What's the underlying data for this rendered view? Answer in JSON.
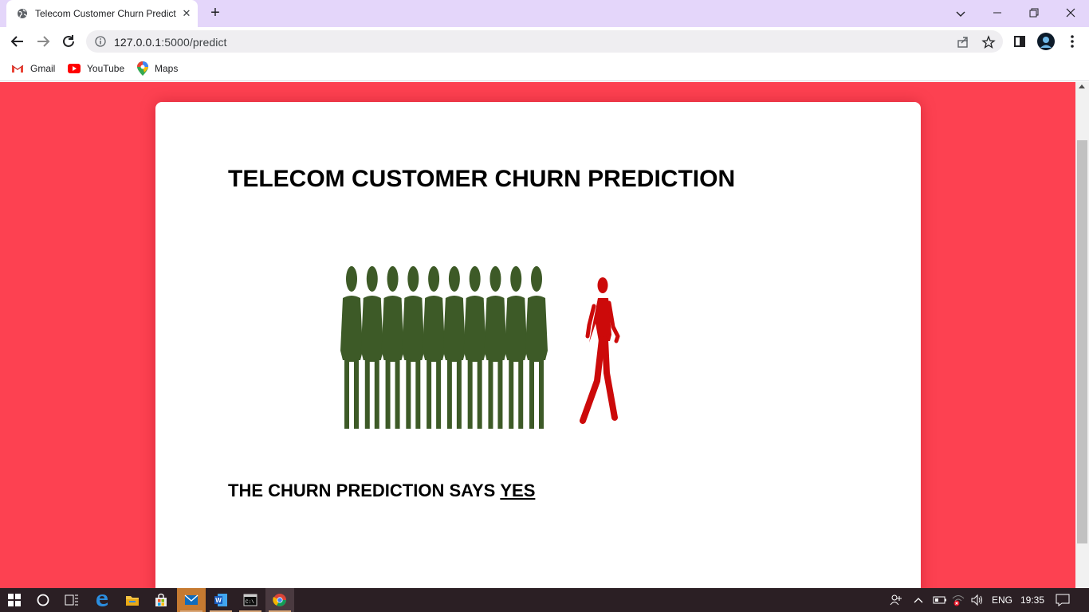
{
  "browser": {
    "tab": {
      "title": "Telecom Customer Churn Predict",
      "close": "✕"
    },
    "new_tab": "+",
    "window_controls": {
      "list": "⌄",
      "minimize": "—",
      "restore": "❐",
      "close": "✕"
    },
    "address_bar": {
      "host": "127.0.0.1",
      "path": ":5000/predict"
    },
    "bookmarks": [
      {
        "label": "Gmail",
        "icon": "gmail-icon"
      },
      {
        "label": "YouTube",
        "icon": "youtube-icon"
      },
      {
        "label": "Maps",
        "icon": "maps-icon"
      }
    ]
  },
  "page": {
    "heading": "TELECOM CUSTOMER CHURN PREDICTION",
    "illustration": {
      "staying_customers": 10,
      "colors": {
        "staying": "#3d5a27",
        "leaving": "#cc0a0a"
      }
    },
    "result_prefix": "THE CHURN PREDICTION SAYS",
    "result_value": "YES",
    "colors": {
      "background": "#fd4151",
      "card": "#ffffff"
    }
  },
  "taskbar": {
    "apps": [
      "windows-start-icon",
      "cortana-search-icon",
      "task-view-icon",
      "edge-icon",
      "file-explorer-icon",
      "store-icon",
      "mail-icon",
      "word-icon",
      "terminal-icon",
      "chrome-icon"
    ],
    "tray": {
      "language": "ENG",
      "time": "19:35"
    }
  }
}
